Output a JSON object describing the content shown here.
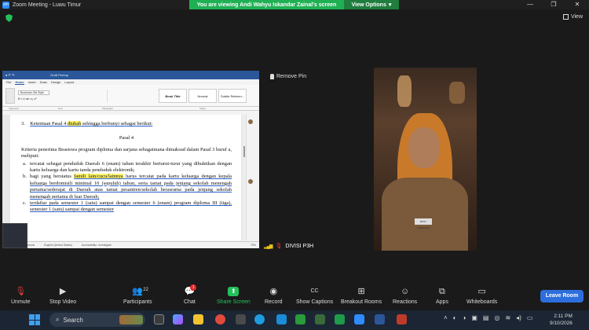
{
  "window": {
    "logo": "zm",
    "title": "Zoom Meeting - Luwu Timur",
    "banner_message": "You are viewing Andi Wahyu Iskandar Zainal's screen",
    "view_options": "View Options",
    "view_label": "View"
  },
  "word": {
    "doc_title": "Draft Perbup",
    "tabs": [
      "File",
      "Home",
      "Insert",
      "Draw",
      "Design",
      "Layout"
    ],
    "font_name": "Bookman Old Style",
    "styles": [
      "Book Title",
      "Normal",
      "Subtle Referen..."
    ],
    "ribbon_groups": [
      "Clipboard",
      "Font",
      "Paragraph",
      "Styles"
    ],
    "status": {
      "page": "598 words",
      "language": "English (United States)",
      "accessibility": "Accessibility: Investigate",
      "zoom": "75%"
    }
  },
  "document": {
    "item3_num": "3.",
    "item3_pre": "Ketentuan Pasal 4 ",
    "item3_hl": "diubah",
    "item3_post": " sehingga berbunyi sebagai berikut:",
    "heading": "Pasal 4",
    "intro": "Kriteria penerima Beasiswa program diploma dan sarjana sebagaimana dimaksud dalam Pasal 3 huruf a, meliputi:",
    "bullets": [
      {
        "marker": "a.",
        "text_pre": "tercatat sebagai penduduk Daerah 6 (enam) tahun terakhir berturut-turut yang dibuktikan dengan kartu keluarga dan kartu tanda penduduk elektronik;",
        "hl": "",
        "text_post": ""
      },
      {
        "marker": "b.",
        "text_pre": "bagi yang berstatus ",
        "hl": "famili lain/cucu/lainnya",
        "text_post": " harus tercatat pada kartu keluarga dengan kepala keluarga berdomisili minimal 10 (sepuluh) tahun, serta tamat pada jenjang sekolah menengah pertama/sederajat di Daerah atau tamat pesantren/sekolah berasrama pada jenjang sekolah menengah pertama di luar Daerah;"
      },
      {
        "marker": "c.",
        "text_pre": "terdaftar pada semester 1 (satu) sampai dengan semester 6 (enam) program diploma III (tiga), semester 1 (satu) sampai dengan semester",
        "hl": "",
        "text_post": ""
      }
    ]
  },
  "participant": {
    "remove_pin": "Remove Pin",
    "name": "DIVISI P3H",
    "badge_text": "ROSY SUPRIANTI"
  },
  "toolbar": {
    "unmute": "Unmute",
    "stop_video": "Stop Video",
    "participants": "Participants",
    "participants_count": "22",
    "chat": "Chat",
    "chat_badge": "1",
    "share_screen": "Share Screen",
    "record": "Record",
    "show_captions": "Show Captions",
    "breakout_rooms": "Breakout Rooms",
    "reactions": "Reactions",
    "apps": "Apps",
    "whiteboards": "Whiteboards",
    "leave": "Leave Room"
  },
  "taskbar": {
    "search": "Search",
    "time": "2:11 PM",
    "date": "9/10/2026"
  }
}
